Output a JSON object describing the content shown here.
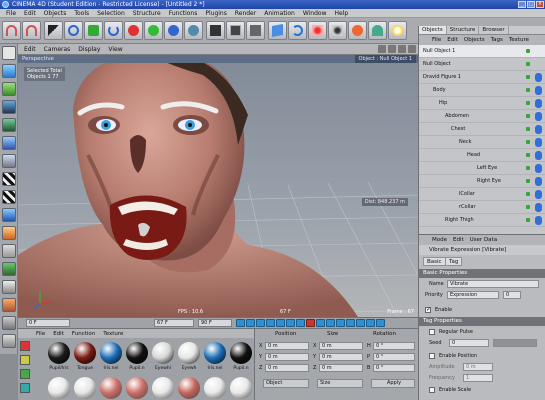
{
  "window": {
    "title": "CINEMA 4D (Student Edition - Restricted License) - [Untitled 2 *]"
  },
  "menubar": [
    "File",
    "Edit",
    "Objects",
    "Tools",
    "Selection",
    "Structure",
    "Functions",
    "Plugins",
    "Render",
    "Animation",
    "Window",
    "Help"
  ],
  "viewport": {
    "menu": [
      "Edit",
      "Cameras",
      "Display",
      "View"
    ],
    "header_label": "Perspective",
    "object_label": "Object : Null Object 1",
    "stats_line1": "Selected Total",
    "stats_line2": "Objects  1      77",
    "distance": "Dist: 848.237 m",
    "fps": "FPS : 10.6",
    "mid_label": "67 F",
    "frame": "Frame : 67"
  },
  "timeline": {
    "start": "0 F",
    "current": "67 F",
    "end": "90 F"
  },
  "materials": {
    "menu": [
      "File",
      "Edit",
      "Function",
      "Texture"
    ],
    "row1": [
      {
        "label": "Pupil/Iris",
        "color": "#1a1a1a"
      },
      {
        "label": "Tongue",
        "color": "#7a1d12"
      },
      {
        "label": "Iris.nel",
        "color": "#1e6fb8"
      },
      {
        "label": "Pupil.n",
        "color": "#111111"
      },
      {
        "label": "Eyewhi",
        "color": "#d8d8d8"
      },
      {
        "label": "Eyewh",
        "color": "#e6e6e6"
      },
      {
        "label": "Iris.nel",
        "color": "#1e6fb8"
      },
      {
        "label": "Pupil.n",
        "color": "#111111"
      }
    ],
    "row2_colors": [
      "#e8e8e8",
      "#e6e6e6",
      "#cc6e66",
      "#cc6e66",
      "#e8e8e8",
      "#c4655d",
      "#e8e8e8",
      "#e8e8e8"
    ]
  },
  "coords": {
    "headers": {
      "position": "Position",
      "size": "Size",
      "rotation": "Rotation"
    },
    "rows": [
      {
        "axis": "X",
        "pos": "0 m",
        "size": "0 m",
        "rot_label": "H",
        "rot": "0 °"
      },
      {
        "axis": "Y",
        "pos": "0 m",
        "size": "0 m",
        "rot_label": "P",
        "rot": "0 °"
      },
      {
        "axis": "Z",
        "pos": "0 m",
        "size": "0 m",
        "rot_label": "B",
        "rot": "0 °"
      }
    ],
    "mode_select": "Object",
    "size_select": "Size",
    "apply": "Apply"
  },
  "object_manager": {
    "tabs": [
      "Objects",
      "Structure",
      "Browser"
    ],
    "menu": [
      "File",
      "Edit",
      "Objects",
      "Tags",
      "Texture"
    ],
    "rows": [
      {
        "name": "Null Object 1",
        "indent": 4,
        "selected": true,
        "tag": false
      },
      {
        "name": "Null Object",
        "indent": 4,
        "selected": false,
        "tag": false
      },
      {
        "name": "Dravid Figure 1",
        "indent": 4,
        "selected": false,
        "tag": true
      },
      {
        "name": "Body",
        "indent": 14,
        "selected": false,
        "tag": true
      },
      {
        "name": "Hip",
        "indent": 20,
        "selected": false,
        "tag": true
      },
      {
        "name": "Abdomen",
        "indent": 26,
        "selected": false,
        "tag": true
      },
      {
        "name": "Chest",
        "indent": 32,
        "selected": false,
        "tag": true
      },
      {
        "name": "Neck",
        "indent": 40,
        "selected": false,
        "tag": true
      },
      {
        "name": "Head",
        "indent": 48,
        "selected": false,
        "tag": true
      },
      {
        "name": "Left Eye",
        "indent": 58,
        "selected": false,
        "tag": true
      },
      {
        "name": "Right Eye",
        "indent": 58,
        "selected": false,
        "tag": true
      },
      {
        "name": "lCollar",
        "indent": 40,
        "selected": false,
        "tag": true
      },
      {
        "name": "rCollar",
        "indent": 40,
        "selected": false,
        "tag": true
      },
      {
        "name": "Right Thigh",
        "indent": 26,
        "selected": false,
        "tag": true
      }
    ]
  },
  "attributes": {
    "menu": [
      "Mode",
      "Edit",
      "User Data"
    ],
    "title": "Vibrate Expression [Vibrate]",
    "tabs": [
      "Basic",
      "Tag"
    ],
    "section_basic": "Basic Properties",
    "name_label": "Name",
    "name_value": "Vibrate",
    "priority_label": "Priority",
    "priority_value": "Expression",
    "priority_num": "0",
    "section_tag": "Tag Properties",
    "enable_label": "Enable",
    "regular_pulse": "Regular Pulse",
    "seed_label": "Seed",
    "seed_value": "0",
    "enable_position": "Enable Position",
    "amplitude_label": "Amplitude",
    "frequency_label": "Frequency",
    "amp_value": "0 m",
    "freq_value": "1",
    "enable_scale": "Enable Scale"
  },
  "colors": {
    "accent": "#2f6fd6",
    "title_bar": "#1f43a6",
    "record": "#c23a2f"
  }
}
